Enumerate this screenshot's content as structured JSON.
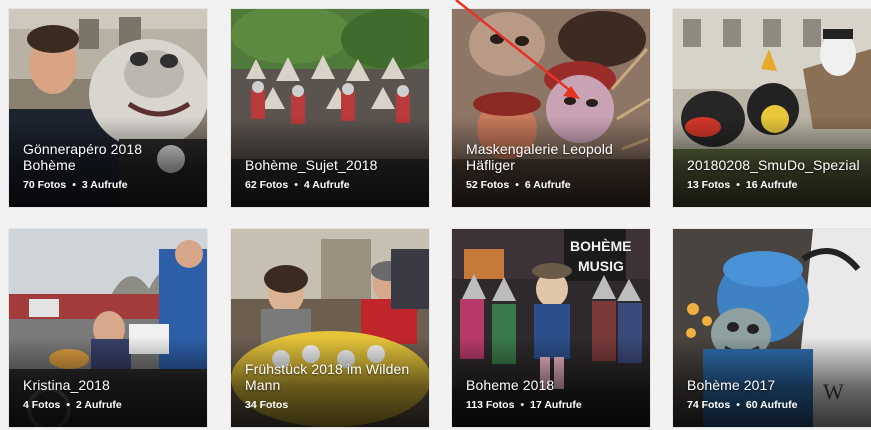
{
  "separator": "•",
  "albums": [
    {
      "title": "Gönnerapéro 2018 Bohème",
      "photos": "70 Fotos",
      "views": "3 Aufrufe"
    },
    {
      "title": "Bohème_Sujet_2018",
      "photos": "62 Fotos",
      "views": "4 Aufrufe"
    },
    {
      "title": "Maskengalerie Leopold Häfliger",
      "photos": "52 Fotos",
      "views": "6 Aufrufe"
    },
    {
      "title": "20180208_SmuDo_Spezial",
      "photos": "13 Fotos",
      "views": "16 Aufrufe"
    },
    {
      "title": "Kristina_2018",
      "photos": "4 Fotos",
      "views": "2 Aufrufe"
    },
    {
      "title": "Frühstück 2018 im Wilden Mann",
      "photos": "34 Fotos",
      "views": ""
    },
    {
      "title": "Boheme 2018",
      "photos": "113 Fotos",
      "views": "17 Aufrufe"
    },
    {
      "title": "Bohème 2017",
      "photos": "74 Fotos",
      "views": "60 Aufrufe"
    }
  ],
  "colors": {
    "background": "#f2f2f2",
    "annotation_arrow": "#e53325"
  },
  "icons": {
    "annotation": "red-arrow-annotation"
  }
}
